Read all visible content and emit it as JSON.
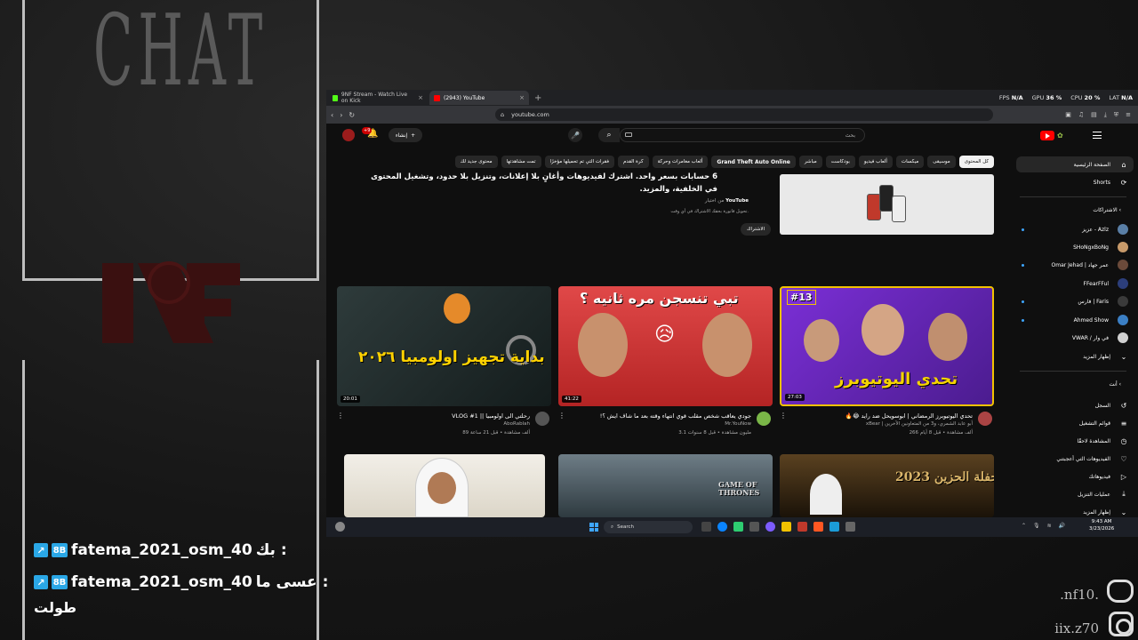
{
  "overlay": {
    "chat_title": "CHAT",
    "messages": [
      {
        "user": "fatema_2021_osm_40",
        "text": "بك :"
      },
      {
        "user": "fatema_2021_osm_40",
        "text": "عسى ما :",
        "continuation": "طولت"
      }
    ],
    "corner_text_1": ".nf10.",
    "corner_text_2": "iix.z70"
  },
  "browser": {
    "tabs": [
      {
        "label": "9NF Stream - Watch Live on Kick",
        "favicon_color": "#53fc18"
      },
      {
        "label": "(2943) YouTube",
        "favicon_color": "#ff0000"
      }
    ],
    "url": "youtube.com",
    "perf": {
      "fps_label": "FPS",
      "fps": "N/A",
      "gpu_label": "GPU",
      "gpu": "36 %",
      "cpu_label": "CPU",
      "cpu": "20 %",
      "lat_label": "LAT",
      "lat": "N/A"
    }
  },
  "youtube": {
    "search_placeholder": "بحث",
    "create_label": "إنشاء",
    "notif_badge": "+9",
    "chips": [
      {
        "label": "كل المحتوى",
        "active": true
      },
      {
        "label": "موسيقى"
      },
      {
        "label": "ميكسات"
      },
      {
        "label": "ألعاب فيديو"
      },
      {
        "label": "بودكاست"
      },
      {
        "label": "مباشر"
      },
      {
        "label": "Grand Theft Auto Online",
        "bold": true
      },
      {
        "label": "ألعاب مغامرات وحركة"
      },
      {
        "label": "كرة القدم"
      },
      {
        "label": "فقرات التي تم تحميلها مؤخرًا"
      },
      {
        "label": "تمت مشاهدتها"
      },
      {
        "label": "محتوى جديد لك"
      }
    ],
    "sidebar": {
      "home": "الصفحة الرئيسية",
      "shorts": "Shorts",
      "subs_header": "الاشتراكات",
      "subs": [
        {
          "name": "عزيز - Azlz",
          "color": "#5a7fa6",
          "dot": true
        },
        {
          "name": "SHoNgxBoNg",
          "color": "#c79a6a",
          "dot": false
        },
        {
          "name": "Omar Jehad | عمر جهاد",
          "color": "#6b4a3a",
          "dot": true
        },
        {
          "name": "FFearFFul",
          "color": "#2c3e7a",
          "dot": false
        },
        {
          "name": "فارس | Faris",
          "color": "#3a3a3a",
          "dot": true
        },
        {
          "name": "Ahmed Show",
          "color": "#3b7fc4",
          "dot": true
        },
        {
          "name": "VWAR / في وار",
          "color": "#d0d0d0",
          "dot": false
        }
      ],
      "show_more": "إظهار المزيد",
      "you_header": "أنت",
      "you_items": [
        {
          "label": "السجل",
          "icon": "history-icon",
          "glyph": "↺"
        },
        {
          "label": "قوائم التشغيل",
          "icon": "playlist-icon",
          "glyph": "≡"
        },
        {
          "label": "المشاهدة لاحقًا",
          "icon": "clock-icon",
          "glyph": "◷"
        },
        {
          "label": "الفيديوهات التي أعجبتني",
          "icon": "thumb-up-icon",
          "glyph": "👍"
        },
        {
          "label": "فيديوهاتك",
          "icon": "video-icon",
          "glyph": "▷"
        },
        {
          "label": "عمليات التنزيل",
          "icon": "download-icon",
          "glyph": "⤓"
        },
        {
          "label": "إظهار المزيد",
          "icon": "chevron-down-icon",
          "glyph": "⌄"
        }
      ]
    },
    "promo": {
      "title": "6 حسابات بسعر واحد. اشترك لفيديوهات وأغانٍ بلا إعلانات، وتنزيل بلا حدود، وتشغيل المحتوى في الخلفية، والمزيد.",
      "brand_prefix": "من اختيار",
      "brand": "YouTube",
      "note": "تحويل فاتورة بحقك الاشتراك في أي وقت.",
      "button": "الاشتراك"
    },
    "videos": [
      {
        "thumb_text": "تحدي اليوتيوبرز",
        "thumb_badge": "#13",
        "thumb_color": "#6a2bbd",
        "duration": "27:03",
        "title": "تحدي اليوتيوبرز الرمضاني | ابوسويحل ضد رايد 😂🔥",
        "channel": "xBear | أبو عابد الشمري، و3 من المتعاونين الآخرين",
        "stats": "266 ألف مشاهدة • قبل 8 أيام",
        "avatar_color": "#aa4444"
      },
      {
        "thumb_text": "تبي تنسجن مره ثانيه ؟",
        "thumb_color": "#d43a3a",
        "duration": "41:22",
        "title": "جودي يعاقب شخص مقلب قوي انتهاء وقته بعد ما شاف ايش ؟!",
        "channel": "Mr.YouNow",
        "stats": "3.1 مليون مشاهدة • قبل 8 سنوات",
        "avatar_color": "#7ab648"
      },
      {
        "thumb_text": "بداية تجهيز اولومبيا ٢٠٢٦",
        "thumb_color": "#1c2a2a",
        "duration": "20:01",
        "title": "رحلتي الى اولومبيا || VLOG #1",
        "channel": "AboRablah",
        "stats": "89 ألف مشاهدة • قبل 21 ساعة",
        "avatar_color": "#555555"
      }
    ],
    "row2": [
      {
        "thumb_color": "#e8e4dc",
        "label": ""
      },
      {
        "thumb_color": "#3d4a52",
        "label": "GAME OF THRONES"
      },
      {
        "thumb_color": "#5a4120",
        "label": "حفلة الحزين 2023"
      }
    ]
  },
  "taskbar": {
    "search": "Search",
    "time": "9:43 AM",
    "date": "3/23/2026"
  }
}
